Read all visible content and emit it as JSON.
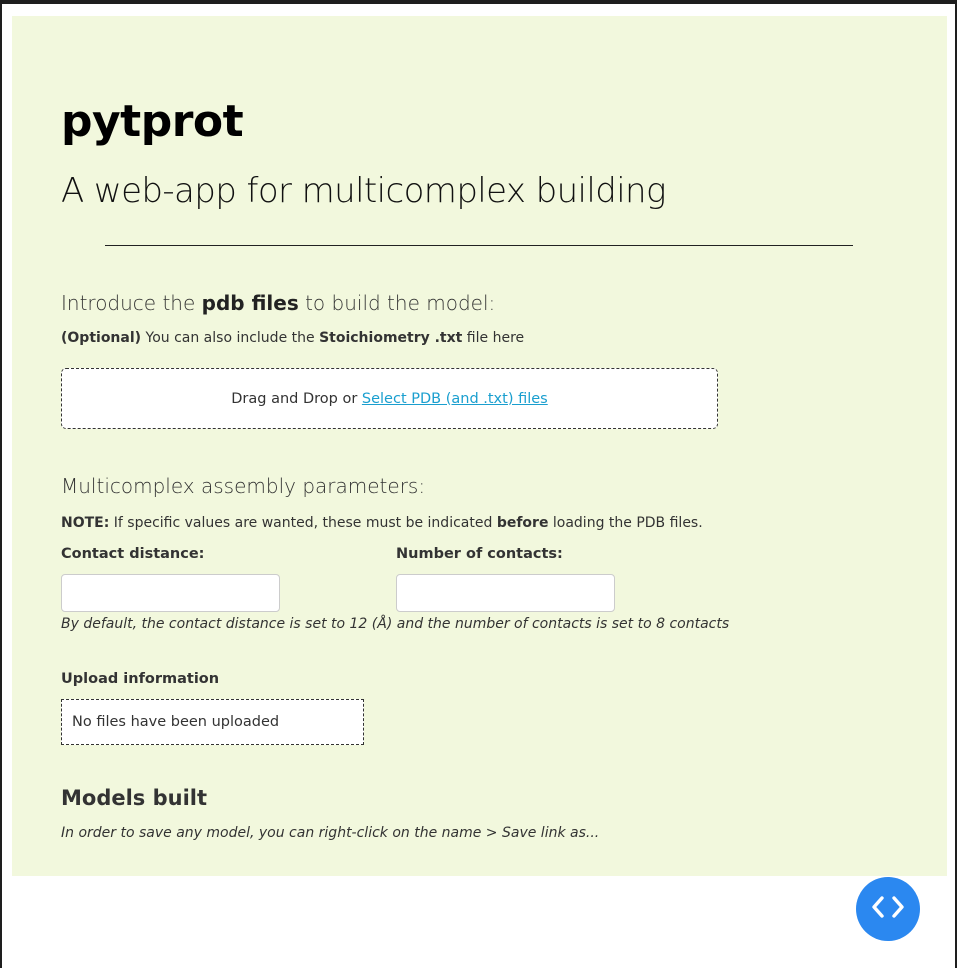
{
  "header": {
    "title": "pytprot",
    "subtitle": "A web-app for multicomplex building"
  },
  "upload_section": {
    "heading_prefix": "Introduce the ",
    "heading_bold": "pdb files",
    "heading_suffix": " to build the model:",
    "optional_bold": "(Optional)",
    "optional_text": " You can also include the ",
    "optional_file_bold": "Stoichiometry .txt",
    "optional_suffix": " file here",
    "dropzone_text": "Drag and Drop or ",
    "dropzone_link": "Select PDB (and .txt) files"
  },
  "parameters": {
    "heading": "Multicomplex assembly parameters:",
    "note_bold": "NOTE:",
    "note_text": " If specific values are wanted, these must be indicated ",
    "note_before": "before",
    "note_suffix": " loading the PDB files.",
    "contact_distance_label": "Contact distance:",
    "contact_distance_value": "",
    "number_of_contacts_label": "Number of contacts:",
    "number_of_contacts_value": "",
    "default_hint": "By default, the contact distance is set to 12 (Å) and the number of contacts is set to 8 contacts"
  },
  "upload_info": {
    "label": "Upload information",
    "status": "No files have been uploaded"
  },
  "models": {
    "heading": "Models built",
    "hint": "In order to save any model, you can right-click on the name > Save link as..."
  },
  "fab": {
    "icon": "code-icon",
    "color": "#2b88f0"
  },
  "colors": {
    "panel_background": "#f2f8dd",
    "link": "#1a9fcf"
  }
}
